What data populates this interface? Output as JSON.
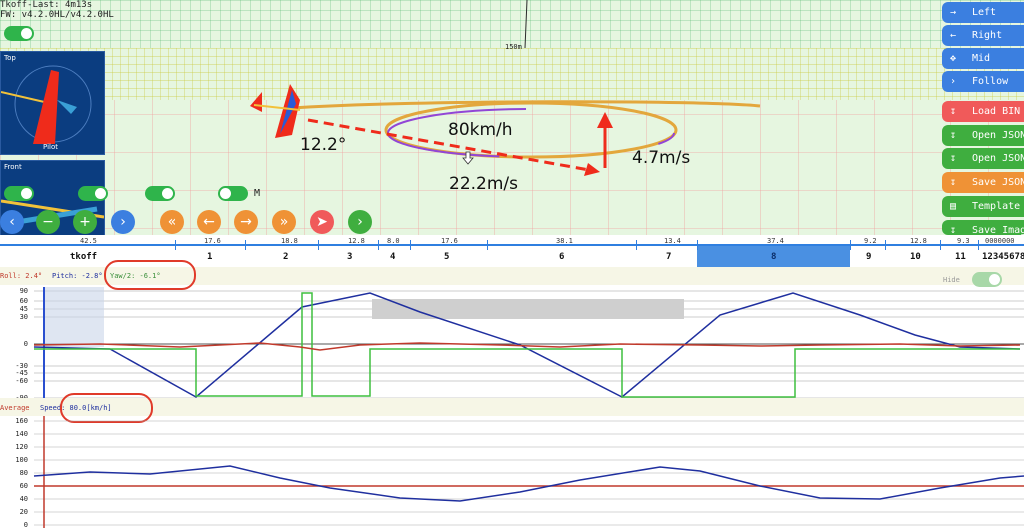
{
  "info": {
    "takeoff_last": "Tkoff-Last: 4m13s",
    "version": "FW: v4.2.0HL/v4.2.0HL"
  },
  "views": {
    "top_label": "Top",
    "pilot_label": "Pilot",
    "front_label": "Front"
  },
  "scene": {
    "speed_label": "80km/h",
    "bank_label": "12.2°",
    "climb_label": "4.7m/s",
    "sink_label": "22.2m/s",
    "altitude_marker": "150m",
    "mode_toggle_label": "M"
  },
  "nav_buttons": [
    {
      "label": "Left",
      "icon": "arrow-right-icon"
    },
    {
      "label": "Right",
      "icon": "arrow-left-icon"
    },
    {
      "label": "Mid",
      "icon": "move-icon"
    },
    {
      "label": "Follow",
      "icon": "chevron-right-icon"
    }
  ],
  "file_buttons": [
    {
      "label": "Load BIN",
      "color": "#f05a5a"
    },
    {
      "label": "Open JSON",
      "color": "#3fae3f"
    },
    {
      "label": "Open JSON",
      "color": "#3fae3f"
    },
    {
      "label": "Save JSON",
      "color": "#ef9236"
    },
    {
      "label": "Template",
      "color": "#3fae3f"
    },
    {
      "label": "Save Image",
      "color": "#3fae3f"
    }
  ],
  "timeline": {
    "segments": [
      {
        "label": "tkoff",
        "duration": "42.5"
      },
      {
        "label": "1",
        "duration": "17.6"
      },
      {
        "label": "2",
        "duration": "18.8"
      },
      {
        "label": "3",
        "duration": "12.8"
      },
      {
        "label": "4",
        "duration": "8.0"
      },
      {
        "label": "5",
        "duration": "17.6"
      },
      {
        "label": "6",
        "duration": "38.1"
      },
      {
        "label": "7",
        "duration": "13.4"
      },
      {
        "label": "8",
        "duration": "37.4"
      },
      {
        "label": "9",
        "duration": "9.2"
      },
      {
        "label": "10",
        "duration": "12.8"
      },
      {
        "label": "11",
        "duration": "9.3"
      },
      {
        "label": "12345678",
        "duration": "0000000"
      }
    ],
    "selected": "8"
  },
  "attitude_chart": {
    "roll_label": "Roll: 2.4°",
    "pitch_label": "Pitch: -2.8°",
    "yaw_label": "Yaw/2: -6.1°",
    "hide_label": "Hide",
    "y_ticks": [
      "90",
      "60",
      "45",
      "30",
      "0",
      "-30",
      "-45",
      "-60",
      "-90"
    ],
    "colors": {
      "roll": "#c0392b",
      "pitch": "#3fbf3f",
      "yaw": "#1f2f9f"
    }
  },
  "speed_chart": {
    "average_label": "Average",
    "speed_label": "Speed: 80.0[km/h]",
    "y_ticks": [
      "160",
      "140",
      "120",
      "100",
      "80",
      "60",
      "40",
      "20",
      "0"
    ],
    "colors": {
      "speed": "#1f2f9f",
      "average": "#c0392b"
    }
  }
}
